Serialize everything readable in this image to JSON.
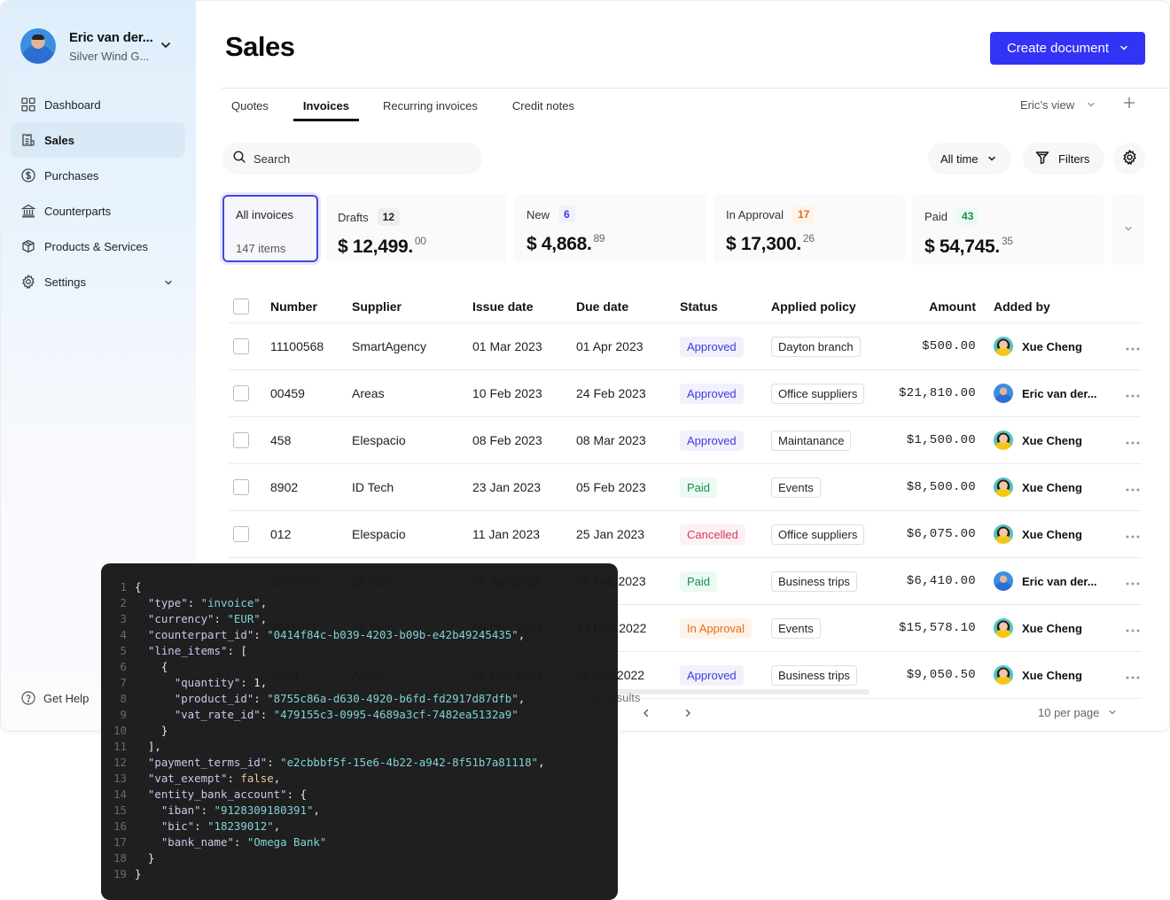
{
  "sidebar": {
    "user": {
      "name": "Eric van der...",
      "org": "Silver Wind G...",
      "avatar": "avatar-eric"
    },
    "items": [
      {
        "label": "Dashboard",
        "icon": "grid-icon",
        "active": false
      },
      {
        "label": "Sales",
        "icon": "receipt-icon",
        "active": true
      },
      {
        "label": "Purchases",
        "icon": "dollar-circle-icon",
        "active": false
      },
      {
        "label": "Counterparts",
        "icon": "bank-icon",
        "active": false
      },
      {
        "label": "Products & Services",
        "icon": "box-icon",
        "active": false
      },
      {
        "label": "Settings",
        "icon": "gear-icon",
        "active": false,
        "expandable": true
      }
    ],
    "help_label": "Get Help"
  },
  "header": {
    "title": "Sales",
    "create_button": "Create document"
  },
  "tabs": [
    {
      "label": "Quotes",
      "active": false
    },
    {
      "label": "Invoices",
      "active": true
    },
    {
      "label": "Recurring invoices",
      "active": false
    },
    {
      "label": "Credit notes",
      "active": false
    }
  ],
  "view": {
    "label": "Eric’s view"
  },
  "toolbar": {
    "search_placeholder": "Search",
    "time_filter": "All time",
    "filters_label": "Filters"
  },
  "summary": {
    "all": {
      "label": "All invoices",
      "count": "147 items"
    },
    "cards": [
      {
        "label": "Drafts",
        "count": "12",
        "amount": "$ 12,499.",
        "cents": "00",
        "badge_bg": "#eeeeef",
        "badge_color": "#222222"
      },
      {
        "label": "New",
        "count": "6",
        "amount": "$ 4,868.",
        "cents": "89",
        "badge_bg": "#f1f1fd",
        "badge_color": "#3d3dd8"
      },
      {
        "label": "In Approval",
        "count": "17",
        "amount": "$ 17,300.",
        "cents": "26",
        "badge_bg": "#fef3e8",
        "badge_color": "#e46c1f"
      },
      {
        "label": "Paid",
        "count": "43",
        "amount": "$ 54,745.",
        "cents": "35",
        "badge_bg": "#ebfaf2",
        "badge_color": "#1a8d4c"
      }
    ]
  },
  "table": {
    "columns": [
      "Number",
      "Supplier",
      "Issue date",
      "Due date",
      "Status",
      "Applied policy",
      "Amount",
      "Added by"
    ],
    "rows": [
      {
        "number": "11100568",
        "supplier": "SmartAgency",
        "issue": "01 Mar 2023",
        "due": "01 Apr 2023",
        "status": "Approved",
        "policy": "Dayton branch",
        "amount": "$500.00",
        "added_by": "Xue Cheng"
      },
      {
        "number": "00459",
        "supplier": "Areas",
        "issue": "10 Feb 2023",
        "due": "24 Feb 2023",
        "status": "Approved",
        "policy": "Office suppliers",
        "amount": "$21,810.00",
        "added_by": "Eric van der..."
      },
      {
        "number": "458",
        "supplier": "Elespacio",
        "issue": "08 Feb 2023",
        "due": "08 Mar 2023",
        "status": "Approved",
        "policy": "Maintanance",
        "amount": "$1,500.00",
        "added_by": "Xue Cheng"
      },
      {
        "number": "8902",
        "supplier": "ID Tech",
        "issue": "23 Jan 2023",
        "due": "05 Feb 2023",
        "status": "Paid",
        "policy": "Events",
        "amount": "$8,500.00",
        "added_by": "Xue Cheng"
      },
      {
        "number": "012",
        "supplier": "Elespacio",
        "issue": "11 Jan 2023",
        "due": "25 Jan 2023",
        "status": "Cancelled",
        "policy": "Office suppliers",
        "amount": "$6,075.00",
        "added_by": "Xue Cheng"
      },
      {
        "number": "6007789",
        "supplier": "ID Tech",
        "issue": "08 Jan 2023",
        "due": "08 Feb 2023",
        "status": "Paid",
        "policy": "Business trips",
        "amount": "$6,410.00",
        "added_by": "Eric van der..."
      },
      {
        "number": "3945011",
        "supplier": "ID Tech",
        "issue": "03 Dec 2022",
        "due": "17 Dec 2022",
        "status": "In Approval",
        "policy": "Events",
        "amount": "$15,578.10",
        "added_by": "Xue Cheng"
      },
      {
        "number": "2963",
        "supplier": "Areas",
        "issue": "08 Dec 2022",
        "due": "08 Jan 2022",
        "status": "Approved",
        "policy": "Business trips",
        "amount": "$9,050.50",
        "added_by": "Xue Cheng"
      }
    ],
    "results_label": "12 results",
    "per_page": "10 per page"
  },
  "code_panel": {
    "lines": [
      [
        [
          "pun",
          "{"
        ]
      ],
      [
        [
          "pun",
          "  "
        ],
        [
          "key",
          "\"type\""
        ],
        [
          "pun",
          ": "
        ],
        [
          "str",
          "\"invoice\""
        ],
        [
          "pun",
          ","
        ]
      ],
      [
        [
          "pun",
          "  "
        ],
        [
          "key",
          "\"currency\""
        ],
        [
          "pun",
          ": "
        ],
        [
          "str",
          "\"EUR\""
        ],
        [
          "pun",
          ","
        ]
      ],
      [
        [
          "pun",
          "  "
        ],
        [
          "key",
          "\"counterpart_id\""
        ],
        [
          "pun",
          ": "
        ],
        [
          "str",
          "\"0414f84c-b039-4203-b09b-e42b49245435\""
        ],
        [
          "pun",
          ","
        ]
      ],
      [
        [
          "pun",
          "  "
        ],
        [
          "key",
          "\"line_items\""
        ],
        [
          "pun",
          ": ["
        ]
      ],
      [
        [
          "pun",
          "    {"
        ]
      ],
      [
        [
          "pun",
          "      "
        ],
        [
          "key",
          "\"quantity\""
        ],
        [
          "pun",
          ": "
        ],
        [
          "num",
          "1"
        ],
        [
          "pun",
          ","
        ]
      ],
      [
        [
          "pun",
          "      "
        ],
        [
          "key",
          "\"product_id\""
        ],
        [
          "pun",
          ": "
        ],
        [
          "str",
          "\"8755c86a-d630-4920-b6fd-fd2917d87dfb\""
        ],
        [
          "pun",
          ","
        ]
      ],
      [
        [
          "pun",
          "      "
        ],
        [
          "key",
          "\"vat_rate_id\""
        ],
        [
          "pun",
          ": "
        ],
        [
          "str",
          "\"479155c3-0995-4689a3cf-7482ea5132a9\""
        ]
      ],
      [
        [
          "pun",
          "    }"
        ]
      ],
      [
        [
          "pun",
          "  ],"
        ]
      ],
      [
        [
          "pun",
          "  "
        ],
        [
          "key",
          "\"payment_terms_id\""
        ],
        [
          "pun",
          ": "
        ],
        [
          "str",
          "\"e2cbbbf5f-15e6-4b22-a942-8f51b7a81118\""
        ],
        [
          "pun",
          ","
        ]
      ],
      [
        [
          "pun",
          "  "
        ],
        [
          "key",
          "\"vat_exempt\""
        ],
        [
          "pun",
          ": "
        ],
        [
          "bool",
          "false"
        ],
        [
          "pun",
          ","
        ]
      ],
      [
        [
          "pun",
          "  "
        ],
        [
          "key",
          "\"entity_bank_account\""
        ],
        [
          "pun",
          ": {"
        ]
      ],
      [
        [
          "pun",
          "    "
        ],
        [
          "key",
          "\"iban\""
        ],
        [
          "pun",
          ": "
        ],
        [
          "str",
          "\"9128309180391\""
        ],
        [
          "pun",
          ","
        ]
      ],
      [
        [
          "pun",
          "    "
        ],
        [
          "key",
          "\"bic\""
        ],
        [
          "pun",
          ": "
        ],
        [
          "str",
          "\"18239012\""
        ],
        [
          "pun",
          ","
        ]
      ],
      [
        [
          "pun",
          "    "
        ],
        [
          "key",
          "\"bank_name\""
        ],
        [
          "pun",
          ": "
        ],
        [
          "str",
          "\"Omega Bank\""
        ]
      ],
      [
        [
          "pun",
          "  }"
        ]
      ],
      [
        [
          "pun",
          "}"
        ]
      ]
    ]
  }
}
